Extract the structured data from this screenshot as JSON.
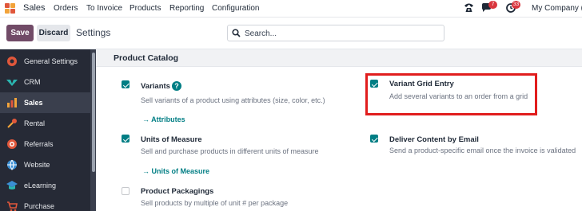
{
  "navbar": {
    "brand": "Sales",
    "menu": [
      "Orders",
      "To Invoice",
      "Products",
      "Reporting",
      "Configuration"
    ],
    "messages_count": "7",
    "activities_count": "33",
    "company": "My Company (S"
  },
  "control_panel": {
    "save_label": "Save",
    "discard_label": "Discard",
    "breadcrumb": "Settings",
    "search_placeholder": "Search..."
  },
  "sidebar": {
    "items": [
      {
        "label": "General Settings",
        "icon": "settings-gear-icon"
      },
      {
        "label": "CRM",
        "icon": "crm-handshake-icon"
      },
      {
        "label": "Sales",
        "icon": "sales-chart-icon",
        "active": true
      },
      {
        "label": "Rental",
        "icon": "rental-key-icon"
      },
      {
        "label": "Referrals",
        "icon": "referrals-icon"
      },
      {
        "label": "Website",
        "icon": "website-globe-icon"
      },
      {
        "label": "eLearning",
        "icon": "elearning-cap-icon"
      },
      {
        "label": "Purchase",
        "icon": "purchase-cart-icon"
      }
    ]
  },
  "section": {
    "title": "Product Catalog",
    "settings": {
      "variants": {
        "title": "Variants",
        "desc": "Sell variants of a product using attributes (size, color, etc.)",
        "link": "→ Attributes",
        "checked": true
      },
      "variant_grid": {
        "title": "Variant Grid Entry",
        "desc": "Add several variants to an order from a grid",
        "checked": true
      },
      "uom": {
        "title": "Units of Measure",
        "desc": "Sell and purchase products in different units of measure",
        "link": "→ Units of Measure",
        "checked": true
      },
      "deliver_email": {
        "title": "Deliver Content by Email",
        "desc": "Send a product-specific email once the invoice is validated",
        "checked": true
      },
      "packagings": {
        "title": "Product Packagings",
        "desc": "Sell products by multiple of unit # per package",
        "checked": false
      }
    }
  },
  "colors": {
    "brand": "#714b67",
    "accent": "#017e84",
    "sidebar_bg": "#262a36",
    "highlight": "#e11d1d",
    "badge": "#d9363e"
  }
}
